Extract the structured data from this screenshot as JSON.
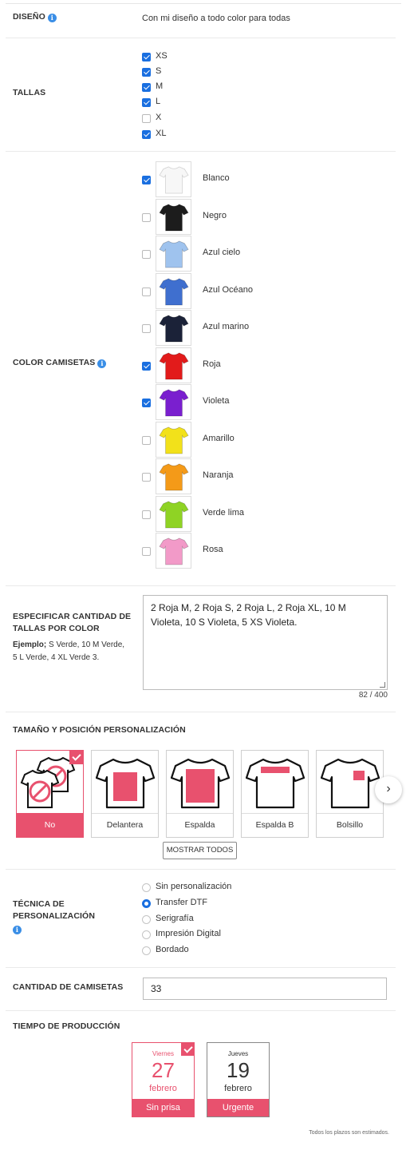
{
  "diseno": {
    "label": "DISEÑO",
    "value": "Con mi diseño a todo color para todas"
  },
  "tallas": {
    "label": "TALLAS",
    "options": [
      {
        "label": "XS",
        "checked": true
      },
      {
        "label": "S",
        "checked": true
      },
      {
        "label": "M",
        "checked": true
      },
      {
        "label": "L",
        "checked": true
      },
      {
        "label": "X",
        "checked": false
      },
      {
        "label": "XL",
        "checked": true
      }
    ]
  },
  "colores": {
    "label": "COLOR CAMISETAS",
    "options": [
      {
        "name": "Blanco",
        "checked": true,
        "color": "#f7f7f7"
      },
      {
        "name": "Negro",
        "checked": false,
        "color": "#1c1c1c"
      },
      {
        "name": "Azul cielo",
        "checked": false,
        "color": "#9fc3ee"
      },
      {
        "name": "Azul Océano",
        "checked": false,
        "color": "#3f6fcf"
      },
      {
        "name": "Azul marino",
        "checked": false,
        "color": "#1b2238"
      },
      {
        "name": "Roja",
        "checked": true,
        "color": "#e21b1b"
      },
      {
        "name": "Violeta",
        "checked": true,
        "color": "#7a1fcf"
      },
      {
        "name": "Amarillo",
        "checked": false,
        "color": "#f2e11a"
      },
      {
        "name": "Naranja",
        "checked": false,
        "color": "#f49a18"
      },
      {
        "name": "Verde lima",
        "checked": false,
        "color": "#8fd324"
      },
      {
        "name": "Rosa",
        "checked": false,
        "color": "#f29ac8"
      }
    ]
  },
  "cantidad_tallas": {
    "label": "ESPECIFICAR CANTIDAD DE TALLAS POR COLOR",
    "example_bold": "Ejemplo;",
    "example_text": " S Verde, 10 M Verde, 5 L Verde, 4 XL Verde 3.",
    "value": "2 Roja M, 2 Roja S, 2 Roja L, 2 Roja XL, 10 M Violeta, 10 S Violeta, 5 XS Violeta.",
    "counter": "82 / 400"
  },
  "posicion": {
    "label": "TAMAÑO Y POSICIÓN PERSONALIZACIÓN",
    "options": [
      {
        "label": "No",
        "selected": true
      },
      {
        "label": "Delantera",
        "selected": false
      },
      {
        "label": "Espalda",
        "selected": false
      },
      {
        "label": "Espalda B",
        "selected": false
      },
      {
        "label": "Bolsillo",
        "selected": false
      }
    ],
    "show_all": "MOSTRAR TODOS",
    "next_icon": "›"
  },
  "tecnica": {
    "label": "TÉCNICA DE PERSONALIZACIÓN",
    "options": [
      {
        "label": "Sin personalización",
        "checked": false
      },
      {
        "label": "Transfer DTF",
        "checked": true
      },
      {
        "label": "Serigrafía",
        "checked": false
      },
      {
        "label": "Impresión Digital",
        "checked": false
      },
      {
        "label": "Bordado",
        "checked": false
      }
    ]
  },
  "cantidad": {
    "label": "CANTIDAD DE CAMISETAS",
    "value": "33"
  },
  "tiempo": {
    "label": "TIEMPO DE PRODUCCIÓN",
    "options": [
      {
        "weekday": "Viernes",
        "day": "27",
        "month": "febrero",
        "label": "Sin prisa",
        "selected": true
      },
      {
        "weekday": "Jueves",
        "day": "19",
        "month": "febrero",
        "label": "Urgente",
        "selected": false
      }
    ],
    "note": "Todos los plazos son estimados."
  },
  "info_icon": "i",
  "accent_color": "#e8516e",
  "check_color": "#1a6fe0"
}
